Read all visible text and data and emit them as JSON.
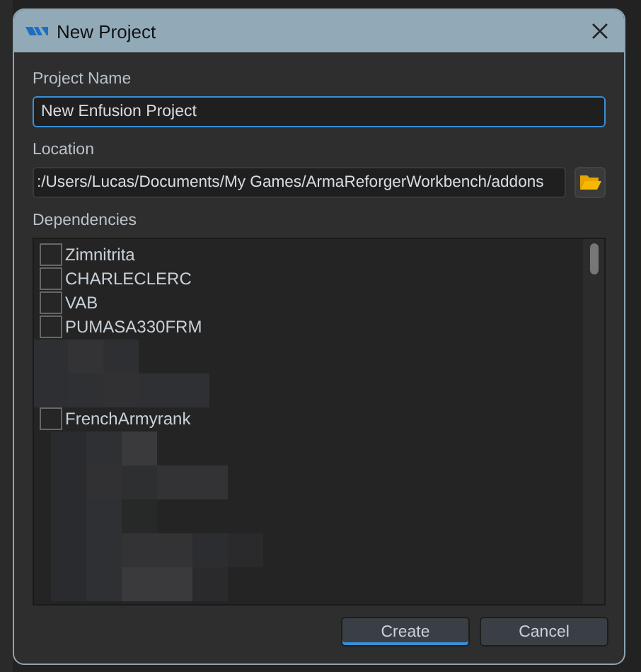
{
  "window": {
    "title": "New Project"
  },
  "project_name": {
    "label": "Project Name",
    "value": "New Enfusion Project",
    "focused": true
  },
  "location": {
    "label": "Location",
    "value": ":/Users/Lucas/Documents/My Games/ArmaReforgerWorkbench/addons"
  },
  "dependencies": {
    "label": "Dependencies",
    "items": [
      {
        "kind": "entry",
        "name": "Zimnitrita",
        "checked": false
      },
      {
        "kind": "entry",
        "name": "CHARLECLERC",
        "checked": false
      },
      {
        "kind": "entry",
        "name": "VAB",
        "checked": false
      },
      {
        "kind": "entry",
        "name": "PUMASA330FRM",
        "checked": false
      },
      {
        "kind": "redacted"
      },
      {
        "kind": "entry",
        "name": "FrenchArmyrank",
        "checked": false
      },
      {
        "kind": "redacted"
      }
    ]
  },
  "buttons": [
    {
      "label": "Create",
      "default": true
    },
    {
      "label": "Cancel",
      "default": false
    }
  ]
}
